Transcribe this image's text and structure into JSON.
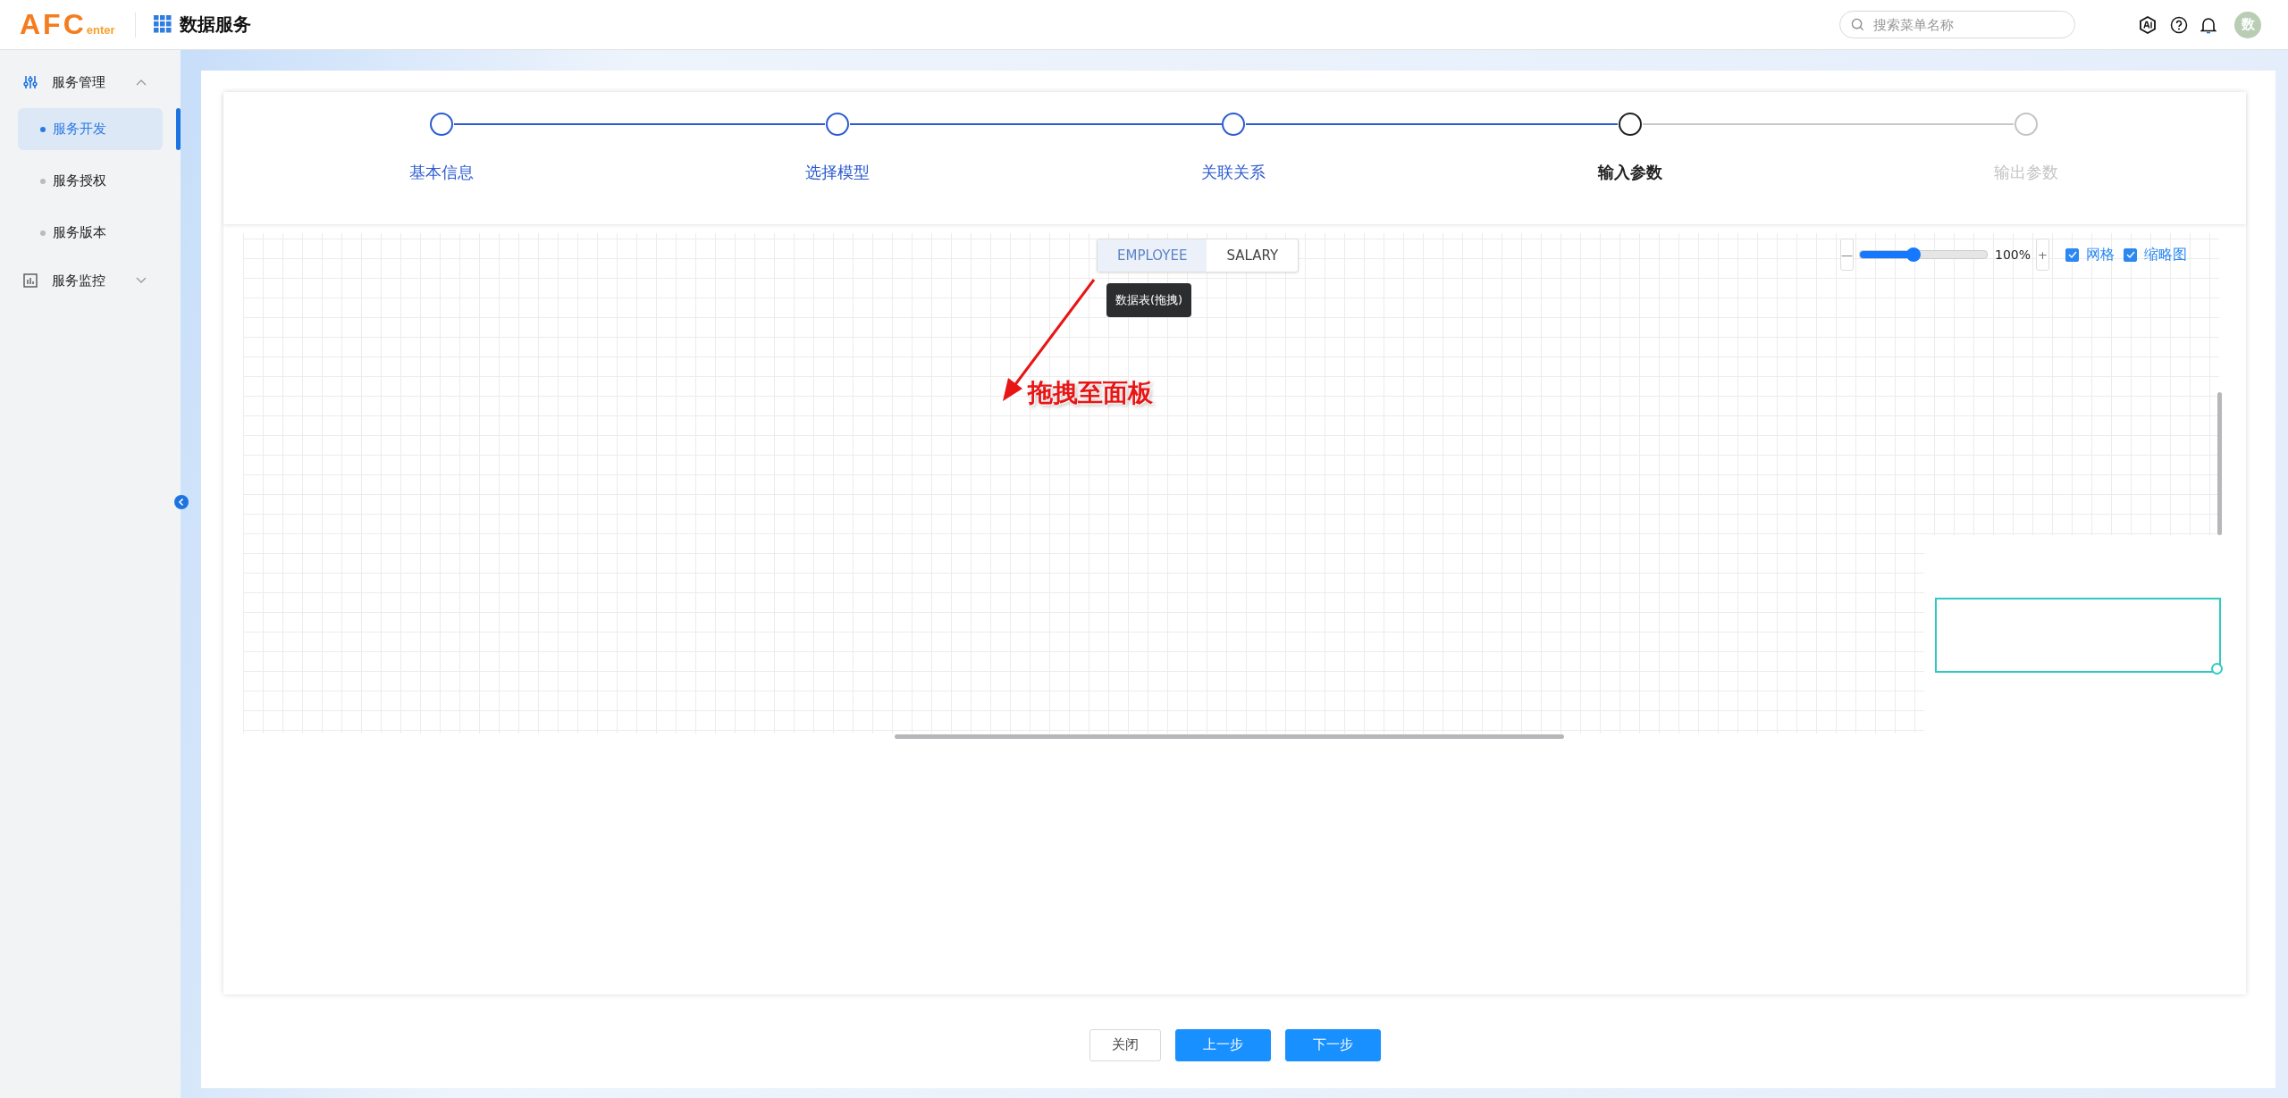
{
  "header": {
    "logo": {
      "main": "AFC",
      "sub": "enter"
    },
    "title": "数据服务",
    "search": {
      "placeholder": "搜索菜单名称"
    },
    "avatar": "数"
  },
  "sidebar": {
    "groups": [
      {
        "label": "服务管理",
        "expanded": true,
        "children": [
          {
            "label": "服务开发",
            "selected": true
          },
          {
            "label": "服务授权",
            "selected": false
          },
          {
            "label": "服务版本",
            "selected": false
          }
        ]
      },
      {
        "label": "服务监控",
        "expanded": false
      }
    ]
  },
  "steps": [
    {
      "label": "基本信息",
      "completed": true,
      "selected": false
    },
    {
      "label": "选择模型",
      "completed": true,
      "selected": false
    },
    {
      "label": "关联关系",
      "completed": true,
      "selected": false
    },
    {
      "label": "输入参数",
      "completed": false,
      "selected": true
    },
    {
      "label": "输出参数",
      "completed": false,
      "selected": false
    }
  ],
  "canvas": {
    "tables": [
      {
        "label": "EMPLOYEE",
        "selected": true
      },
      {
        "label": "SALARY",
        "selected": false
      }
    ],
    "tooltip": "数据表(拖拽)",
    "annotation": "拖拽至面板",
    "zoom": {
      "level": 0.42,
      "reading": "100%",
      "minus": "—",
      "plus": "+"
    },
    "toggles": [
      {
        "label": "网格",
        "checked": true
      },
      {
        "label": "缩略图",
        "checked": true
      }
    ]
  },
  "buttons": [
    {
      "label": "关闭",
      "kind": "default"
    },
    {
      "label": "上一步",
      "kind": "primary"
    },
    {
      "label": "下一步",
      "kind": "primary"
    }
  ]
}
